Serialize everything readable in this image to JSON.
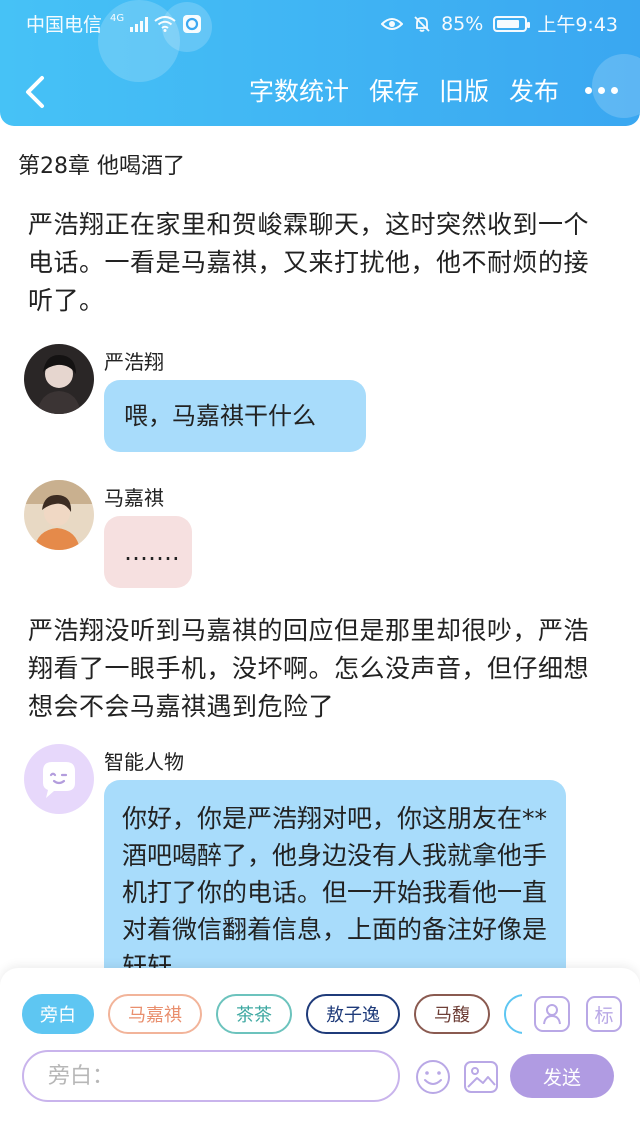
{
  "status_bar": {
    "carrier": "中国电信",
    "network": "4G",
    "battery_percent": "85%",
    "battery_level": 0.85,
    "time": "上午9:43"
  },
  "nav": {
    "actions": [
      "字数统计",
      "保存",
      "旧版",
      "发布"
    ]
  },
  "chapter": {
    "title": "第28章 他喝酒了"
  },
  "content": {
    "narration_1": "严浩翔正在家里和贺峻霖聊天，这时突然收到一个电话。一看是马嘉祺，又来打扰他，他不耐烦的接听了。",
    "narration_2": "严浩翔没听到马嘉祺的回应但是那里却很吵，严浩翔看了一眼手机，没坏啊。怎么没声音，但仔细想想会不会马嘉祺遇到危险了",
    "messages": [
      {
        "speaker": "严浩翔",
        "text": "喂，马嘉祺干什么"
      },
      {
        "speaker": "马嘉祺",
        "text": "……."
      },
      {
        "speaker": "智能人物",
        "text": "你好，你是严浩翔对吧，你这朋友在**酒吧喝醉了，他身边没有人我就拿他手机打了你的电话。但一开始我看他一直对着微信翻着信息，上面的备注好像是轩轩"
      }
    ]
  },
  "composer": {
    "chips": [
      "旁白",
      "马嘉祺",
      "茶茶",
      "敖子逸",
      "马馥"
    ],
    "tag_button": "标",
    "input_placeholder": "旁白：",
    "send_label": "发送"
  },
  "colors": {
    "header": "#3aa7f1",
    "bubble_blue": "#a8dcfb",
    "bubble_pink": "#f6e0e0",
    "accent_purple": "#b09be2"
  }
}
